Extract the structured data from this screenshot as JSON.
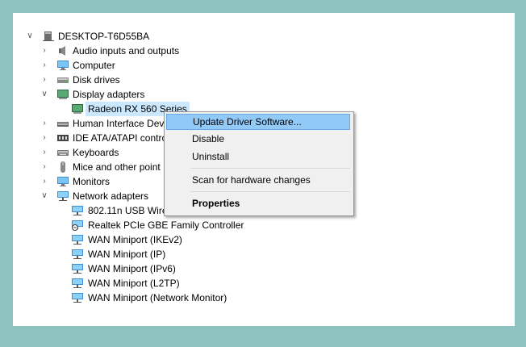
{
  "tree": {
    "root": "DESKTOP-T6D55BA",
    "items": [
      {
        "label": "Audio inputs and outputs"
      },
      {
        "label": "Computer"
      },
      {
        "label": "Disk drives"
      },
      {
        "label": "Display adapters"
      },
      {
        "label": "Radeon RX 560 Series"
      },
      {
        "label": "Human Interface Dev"
      },
      {
        "label": "IDE ATA/ATAPI contro"
      },
      {
        "label": "Keyboards"
      },
      {
        "label": "Mice and other point"
      },
      {
        "label": "Monitors"
      },
      {
        "label": "Network adapters"
      },
      {
        "label": "802.11n USB Wirel"
      },
      {
        "label": "Realtek PCIe GBE Family Controller"
      },
      {
        "label": "WAN Miniport (IKEv2)"
      },
      {
        "label": "WAN Miniport (IP)"
      },
      {
        "label": "WAN Miniport (IPv6)"
      },
      {
        "label": "WAN Miniport (L2TP)"
      },
      {
        "label": "WAN Miniport (Network Monitor)"
      }
    ]
  },
  "menu": {
    "update": "Update Driver Software...",
    "disable": "Disable",
    "uninstall": "Uninstall",
    "scan": "Scan for hardware changes",
    "properties": "Properties"
  },
  "colors": {
    "background": "#8fc3c2",
    "selection": "#cce8ff",
    "menu_highlight": "#91c9f7"
  }
}
